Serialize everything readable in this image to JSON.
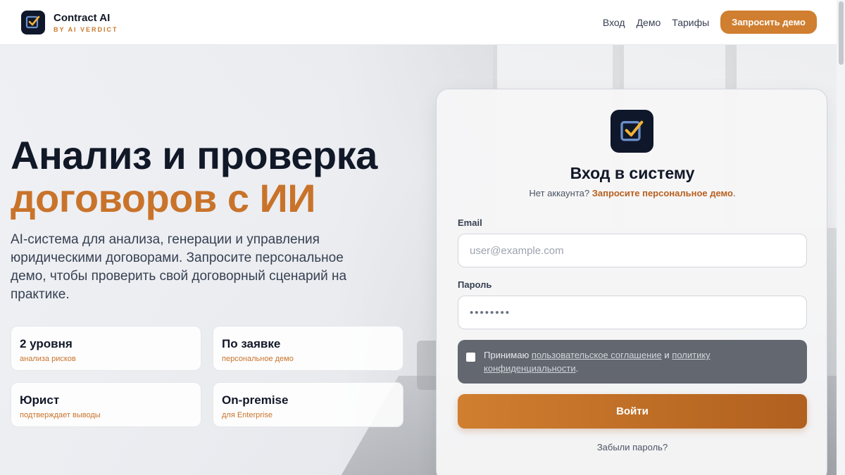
{
  "header": {
    "brand_name": "Contract AI",
    "brand_sub": "BY AI VERDICT",
    "nav": [
      {
        "label": "Вход"
      },
      {
        "label": "Демо"
      },
      {
        "label": "Тарифы"
      }
    ],
    "cta_label": "Запросить демо"
  },
  "hero": {
    "title_line1": "Анализ и проверка",
    "title_line2": "договоров с ИИ",
    "lead": "AI-система для анализа, генерации и управления юридическими договорами. Запросите персональное демо, чтобы проверить свой договорный сценарий на практике.",
    "stats": [
      {
        "title": "2 уровня",
        "sub": "анализа рисков"
      },
      {
        "title": "По заявке",
        "sub": "персональное демо"
      },
      {
        "title": "Юрист",
        "sub": "подтверждает выводы"
      },
      {
        "title": "On-premise",
        "sub": "для Enterprise"
      }
    ]
  },
  "login": {
    "title": "Вход в систему",
    "no_account": "Нет аккаунта?",
    "request_link": "Запросите персональное демо",
    "request_link_suffix": ".",
    "email_label": "Email",
    "email_placeholder": "user@example.com",
    "password_label": "Пароль",
    "password_value": "••••••••",
    "consent_prefix": "Принимаю",
    "consent_link1": "пользовательское соглашение",
    "consent_and": "и",
    "consent_link2": "политику конфиденциальности",
    "consent_suffix": ".",
    "submit_label": "Войти",
    "forgot_label": "Забыли пароль?"
  },
  "colors": {
    "accent": "#d07e2f",
    "accent_dark": "#b1601f",
    "logo_bg": "#0f172a",
    "consent_bg": "#636770"
  },
  "icons": {
    "logo": "check-box-icon"
  }
}
